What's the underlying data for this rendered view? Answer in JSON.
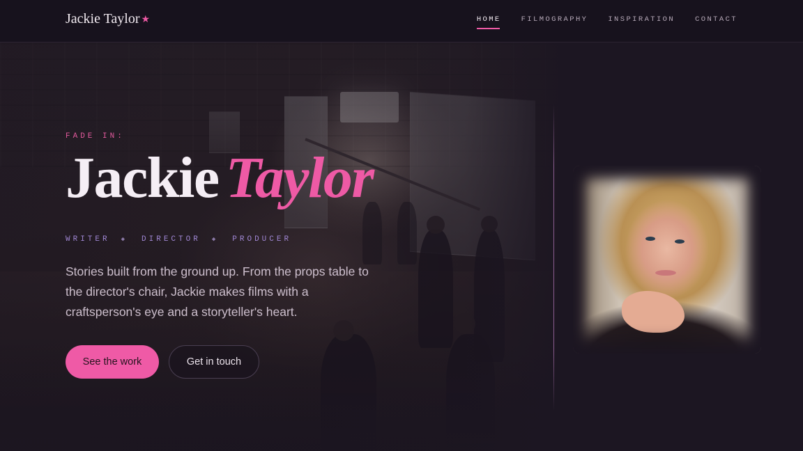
{
  "header": {
    "logo_text": "Jackie Taylor",
    "logo_mark": "★",
    "nav": [
      {
        "label": "HOME",
        "active": true
      },
      {
        "label": "FILMOGRAPHY",
        "active": false
      },
      {
        "label": "INSPIRATION",
        "active": false
      },
      {
        "label": "CONTACT",
        "active": false
      }
    ]
  },
  "hero": {
    "eyebrow": "FADE IN:",
    "first_name": "Jackie",
    "last_name": "Taylor",
    "roles": [
      "WRITER",
      "DIRECTOR",
      "PRODUCER"
    ],
    "role_separator": "◆",
    "tagline": "Stories built from the ground up. From the props table to the director's chair, Jackie makes films with a craftsperson's eye and a storyteller's heart.",
    "primary_cta": "See the work",
    "secondary_cta": "Get in touch"
  },
  "colors": {
    "accent_pink": "#ee5aa5",
    "role_purple": "#a087d4",
    "background": "#1c1622"
  }
}
